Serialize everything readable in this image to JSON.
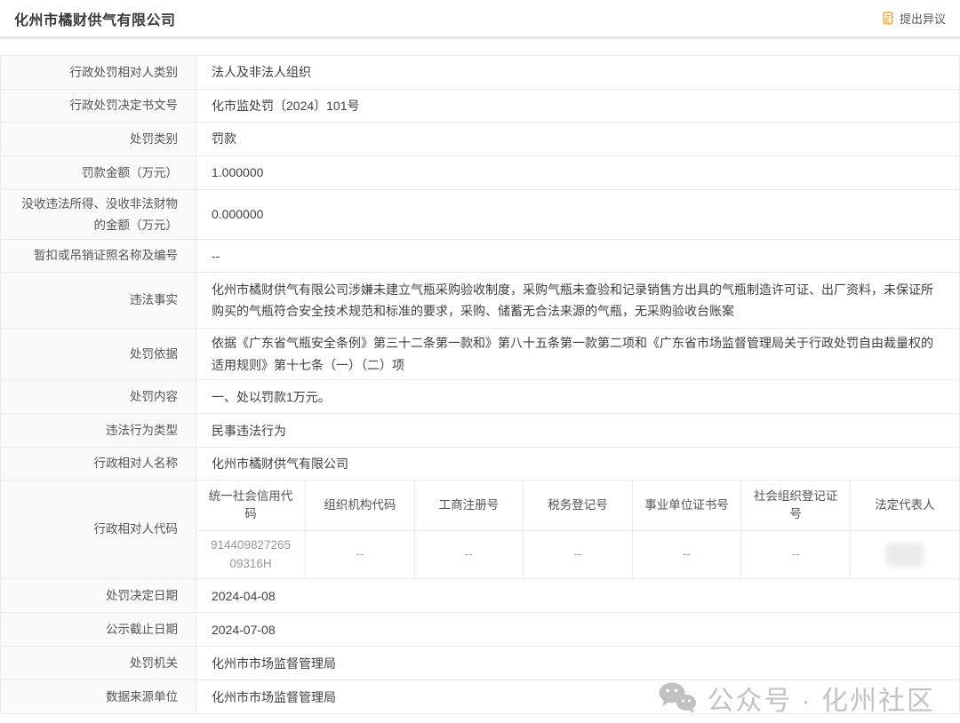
{
  "header": {
    "title": "化州市橘财供气有限公司",
    "dispute_button": "提出异议"
  },
  "colors": {
    "accent": "#f0a32f",
    "border": "#ebebeb",
    "label_bg": "#fafafa",
    "watermark_gray": "#c3c3c3"
  },
  "table": {
    "rows": [
      {
        "type": "simple",
        "label": "行政处罚相对人类别",
        "value": "法人及非法人组织"
      },
      {
        "type": "simple",
        "label": "行政处罚决定书文号",
        "value": "化市监处罚〔2024〕101号"
      },
      {
        "type": "simple",
        "label": "处罚类别",
        "value": "罚款"
      },
      {
        "type": "simple",
        "label": "罚款金额（万元）",
        "value": "1.000000"
      },
      {
        "type": "simple",
        "label": "没收违法所得、没收非法财物的金额（万元）",
        "value": "0.000000"
      },
      {
        "type": "simple",
        "label": "暂扣或吊销证照名称及编号",
        "value": "--"
      },
      {
        "type": "simple",
        "label": "违法事实",
        "value": "化州市橘财供气有限公司涉嫌未建立气瓶采购验收制度，采购气瓶未查验和记录销售方出具的气瓶制造许可证、出厂资料，未保证所购买的气瓶符合安全技术规范和标准的要求，采购、储蓄无合法来源的气瓶，无采购验收台账案"
      },
      {
        "type": "simple",
        "label": "处罚依据",
        "value": "依据《广东省气瓶安全条例》第三十二条第一款和》第八十五条第一款第二项和《广东省市场监督管理局关于行政处罚自由裁量权的适用规则》第十七条（一）（二）项"
      },
      {
        "type": "simple",
        "label": "处罚内容",
        "value": "一、处以罚款1万元。"
      },
      {
        "type": "simple",
        "label": "违法行为类型",
        "value": "民事违法行为"
      },
      {
        "type": "simple",
        "label": "行政相对人名称",
        "value": "化州市橘财供气有限公司"
      },
      {
        "type": "code",
        "label": "行政相对人代码",
        "headers": [
          "统一社会信用代码",
          "组织机构代码",
          "工商注册号",
          "税务登记号",
          "事业单位证书号",
          "社会组织登记证号",
          "法定代表人"
        ],
        "values": [
          "91440982726509316H",
          "--",
          "--",
          "--",
          "--",
          "--",
          ""
        ],
        "redacted_index": 6
      },
      {
        "type": "simple",
        "label": "处罚决定日期",
        "value": "2024-04-08"
      },
      {
        "type": "simple",
        "label": "公示截止日期",
        "value": "2024-07-08"
      },
      {
        "type": "simple",
        "label": "处罚机关",
        "value": "化州市市场监督管理局"
      },
      {
        "type": "simple",
        "label": "数据来源单位",
        "value": "化州市市场监督管理局"
      }
    ]
  },
  "watermark": {
    "text": "公众号 · 化州社区"
  }
}
